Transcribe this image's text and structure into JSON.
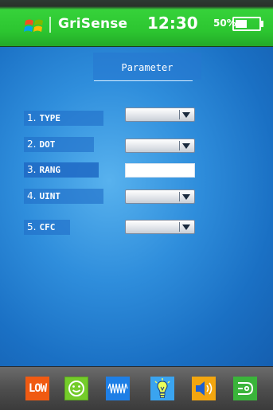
{
  "status_bar": {
    "app_name": "GriSense",
    "time": "12:30",
    "battery_percent": "50%",
    "battery_level": 0.5,
    "icons": [
      "windows-flag-icon",
      "battery-icon"
    ]
  },
  "screen": {
    "title": "Parameter",
    "params": [
      {
        "num": "1.",
        "label": "TYPE",
        "control": "select",
        "value": ""
      },
      {
        "num": "2.",
        "label": "DOT",
        "control": "select",
        "value": ""
      },
      {
        "num": "3.",
        "label": "RANG",
        "control": "input",
        "value": ""
      },
      {
        "num": "4.",
        "label": "UINT",
        "control": "select",
        "value": ""
      },
      {
        "num": "5.",
        "label": "CFC",
        "control": "select",
        "value": ""
      }
    ]
  },
  "toolbar": {
    "low_label": "LOW",
    "icons": [
      "low-battery-icon",
      "smiley-icon",
      "waveform-icon",
      "lightbulb-icon",
      "speaker-icon",
      "sensor-icon"
    ]
  },
  "colors": {
    "status_bar_green": "#2cc530",
    "screen_blue": "#2f8edc",
    "low_orange": "#f05a12",
    "smile_green": "#74cc2a",
    "wave_blue": "#1e7fe6",
    "bulb_blue": "#3aa4f0",
    "speaker_orange": "#f3a60f",
    "sensor_green": "#3ab43a"
  }
}
